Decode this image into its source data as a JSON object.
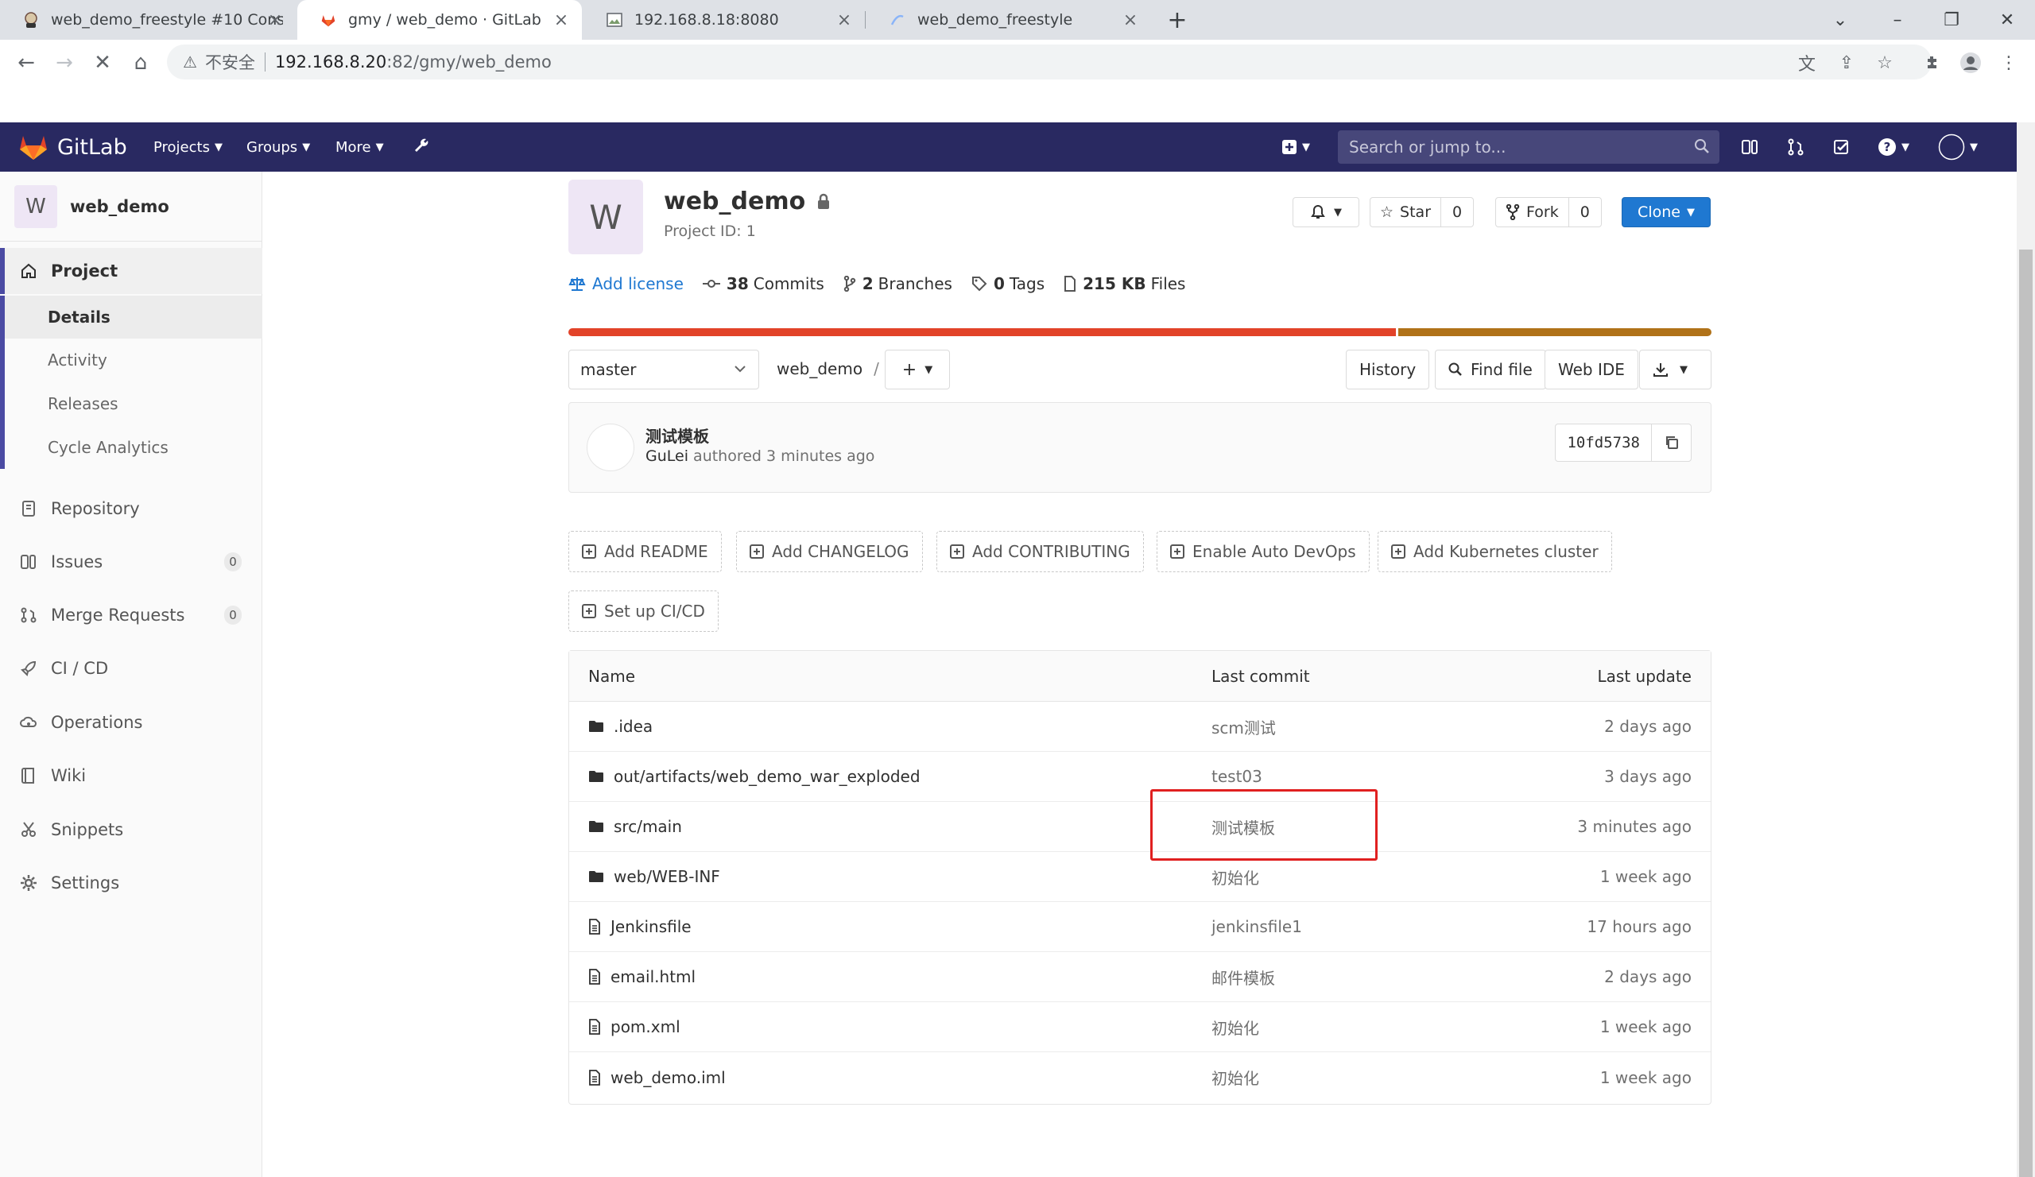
{
  "browser": {
    "tabs": [
      {
        "title": "web_demo_freestyle #10 Cons",
        "active": false
      },
      {
        "title": "gmy / web_demo · GitLab",
        "active": true
      },
      {
        "title": "192.168.8.18:8080",
        "active": false
      },
      {
        "title": "web_demo_freestyle",
        "active": false
      }
    ],
    "insecure_label": "不安全",
    "url_host": "192.168.8.20",
    "url_path": ":82/gmy/web_demo"
  },
  "gitlab_header": {
    "brand": "GitLab",
    "nav": [
      "Projects",
      "Groups",
      "More"
    ],
    "search_placeholder": "Search or jump to...",
    "colors": {
      "header_bg": "#292961",
      "accent": "#1f78d1"
    }
  },
  "sidebar": {
    "project_initial": "W",
    "project_name": "web_demo",
    "project_label": "Project",
    "sub_items": [
      "Details",
      "Activity",
      "Releases",
      "Cycle Analytics"
    ],
    "items": [
      {
        "label": "Repository",
        "icon": "repository-icon"
      },
      {
        "label": "Issues",
        "icon": "issues-icon",
        "count": "0"
      },
      {
        "label": "Merge Requests",
        "icon": "merge-request-icon",
        "count": "0"
      },
      {
        "label": "CI / CD",
        "icon": "rocket-icon"
      },
      {
        "label": "Operations",
        "icon": "cloud-gear-icon"
      },
      {
        "label": "Wiki",
        "icon": "book-icon"
      },
      {
        "label": "Snippets",
        "icon": "scissors-icon"
      },
      {
        "label": "Settings",
        "icon": "gear-icon"
      }
    ]
  },
  "project": {
    "initial": "W",
    "name": "web_demo",
    "id_text": "Project ID: 1",
    "star_label": "Star",
    "star_count": "0",
    "fork_label": "Fork",
    "fork_count": "0",
    "clone_label": "Clone",
    "stats": {
      "add_license": "Add license",
      "commits_num": "38",
      "commits_label": "Commits",
      "branches_num": "2",
      "branches_label": "Branches",
      "tags_num": "0",
      "tags_label": "Tags",
      "files_num": "215 KB",
      "files_label": "Files"
    },
    "language_bar": [
      {
        "share": 0.724,
        "color": "#e24329"
      },
      {
        "share": 0.276,
        "color": "#b07219"
      }
    ]
  },
  "repo_toolbar": {
    "branch": "master",
    "path": "web_demo",
    "slash": "/",
    "history": "History",
    "find_file": "Find file",
    "web_ide": "Web IDE"
  },
  "last_commit": {
    "title": "测试模板",
    "author": "GuLei",
    "meta": "authored 3 minutes ago",
    "sha": "10fd5738"
  },
  "quick_actions": [
    "Add README",
    "Add CHANGELOG",
    "Add CONTRIBUTING",
    "Enable Auto DevOps",
    "Add Kubernetes cluster",
    "Set up CI/CD"
  ],
  "file_tree": {
    "headers": {
      "name": "Name",
      "commit": "Last commit",
      "update": "Last update"
    },
    "rows": [
      {
        "name": ".idea",
        "type": "folder",
        "commit": "scm测试",
        "update": "2 days ago"
      },
      {
        "name": "out/artifacts/web_demo_war_exploded",
        "type": "folder",
        "commit": "test03",
        "update": "3 days ago"
      },
      {
        "name": "src/main",
        "type": "folder",
        "commit": "测试模板",
        "update": "3 minutes ago"
      },
      {
        "name": "web/WEB-INF",
        "type": "folder",
        "commit": "初始化",
        "update": "1 week ago"
      },
      {
        "name": "Jenkinsfile",
        "type": "file",
        "commit": "jenkinsfile1",
        "update": "17 hours ago"
      },
      {
        "name": "email.html",
        "type": "file",
        "commit": "邮件模板",
        "update": "2 days ago"
      },
      {
        "name": "pom.xml",
        "type": "file",
        "commit": "初始化",
        "update": "1 week ago"
      },
      {
        "name": "web_demo.iml",
        "type": "file",
        "commit": "初始化",
        "update": "1 week ago"
      }
    ]
  }
}
